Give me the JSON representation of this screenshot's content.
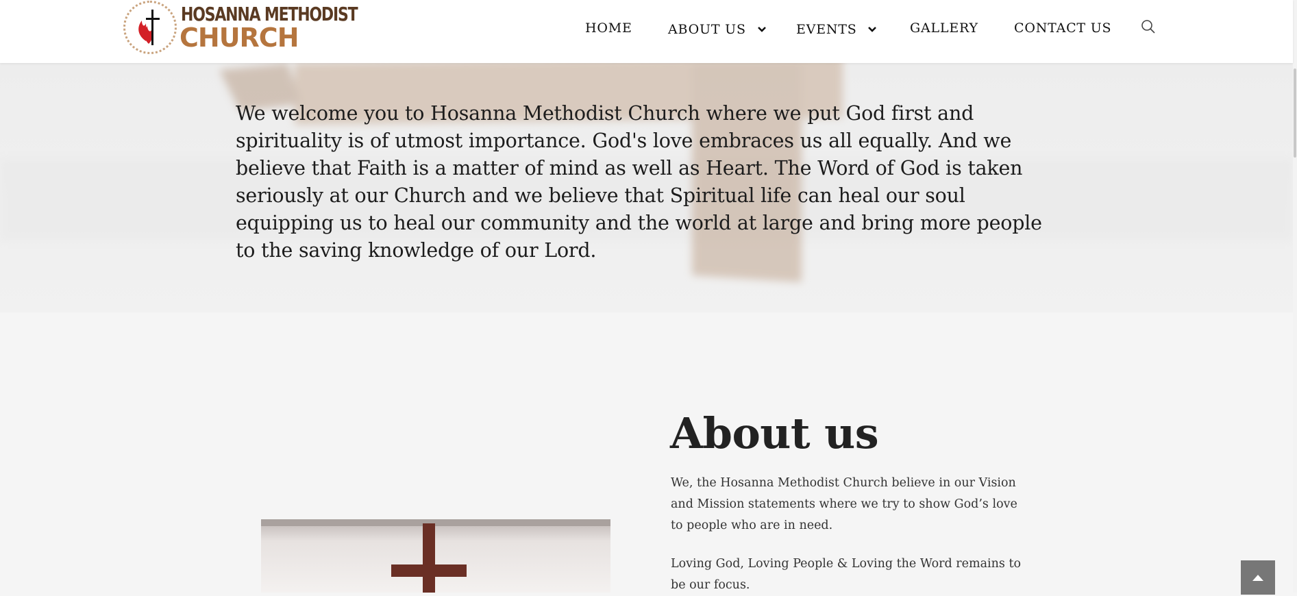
{
  "logo": {
    "line1": "HOSANNA METHODIST",
    "line2": "CHURCH",
    "icon": "cross-and-flame-icon",
    "colors": {
      "flame": "#d32027",
      "text_dark": "#5a3a22",
      "text_light": "#b5753e"
    }
  },
  "nav": {
    "items": [
      {
        "label": "HOME"
      },
      {
        "label": "ABOUT US",
        "icon": "chevron-down-icon"
      },
      {
        "label": "EVENTS",
        "icon": "chevron-down-icon"
      },
      {
        "label": "GALLERY"
      },
      {
        "label": "CONTACT US"
      }
    ],
    "search_icon": "search-icon"
  },
  "hero": {
    "text": "We welcome you to Hosanna Methodist Church where we put God first and spirituality is of utmost importance. God's love embraces us all equally. And we believe that Faith is a matter of mind as well as Heart. The Word of God is taken seriously at our Church and we believe that Spiritual life can heal our soul equipping us to heal our community and the world at large and bring more people to the saving knowledge of our Lord."
  },
  "about": {
    "title": "About us",
    "paragraphs": [
      "We, the Hosanna Methodist Church believe in our Vision and Mission statements where we try to show God’s love to people who are in need.",
      "Loving God, Loving People & Loving the Word remains to be our focus."
    ]
  },
  "scroll_top": {
    "icon": "arrow-up-icon"
  }
}
